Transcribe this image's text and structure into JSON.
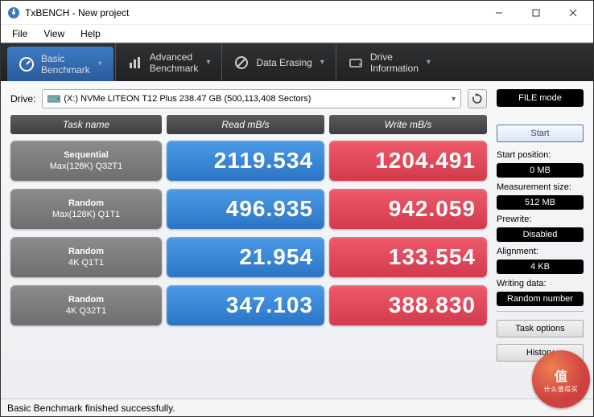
{
  "window": {
    "title": "TxBENCH - New project"
  },
  "menu": {
    "file": "File",
    "view": "View",
    "help": "Help"
  },
  "tabs": {
    "basic": {
      "l1": "Basic",
      "l2": "Benchmark"
    },
    "adv": {
      "l1": "Advanced",
      "l2": "Benchmark"
    },
    "erase": {
      "l1": "Data Erasing",
      "l2": ""
    },
    "drive": {
      "l1": "Drive",
      "l2": "Information"
    }
  },
  "driveLabel": "Drive:",
  "driveValue": "(X:) NVMe LITEON T12 Plus  238.47 GB (500,113,408 Sectors)",
  "headers": {
    "task": "Task name",
    "read": "Read mB/s",
    "write": "Write mB/s"
  },
  "rows": [
    {
      "name1": "Sequential",
      "name2": "Max(128K) Q32T1",
      "read": "2119.534",
      "write": "1204.491"
    },
    {
      "name1": "Random",
      "name2": "Max(128K) Q1T1",
      "read": "496.935",
      "write": "942.059"
    },
    {
      "name1": "Random",
      "name2": "4K Q1T1",
      "read": "21.954",
      "write": "133.554"
    },
    {
      "name1": "Random",
      "name2": "4K Q32T1",
      "read": "347.103",
      "write": "388.830"
    }
  ],
  "side": {
    "fileMode": "FILE mode",
    "start": "Start",
    "startPosLabel": "Start position:",
    "startPosVal": "0 MB",
    "measLabel": "Measurement size:",
    "measVal": "512 MB",
    "prewLabel": "Prewrite:",
    "prewVal": "Disabled",
    "alignLabel": "Alignment:",
    "alignVal": "4 KB",
    "wdLabel": "Writing data:",
    "wdVal": "Random number",
    "taskOpt": "Task options",
    "history": "History"
  },
  "status": "Basic Benchmark finished successfully.",
  "watermark": {
    "main": "值",
    "sub": "什么值得买"
  }
}
